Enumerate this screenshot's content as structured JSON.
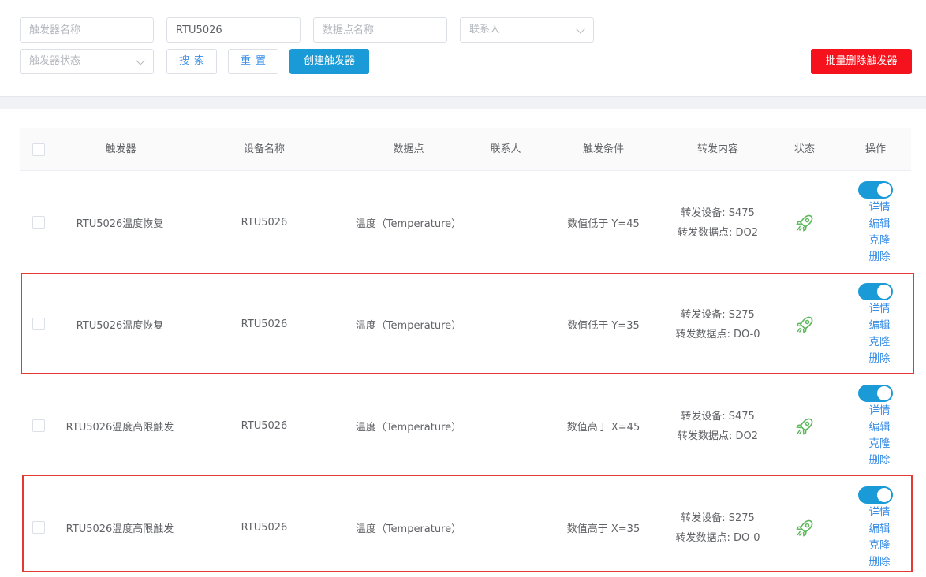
{
  "filters": {
    "trigger_name_placeholder": "触发器名称",
    "device_name_value": "RTU5026",
    "datapoint_name_placeholder": "数据点名称",
    "contact_placeholder": "联系人",
    "trigger_status_placeholder": "触发器状态"
  },
  "buttons": {
    "search": "搜索",
    "reset": "重置",
    "create": "创建触发器",
    "batch_delete": "批量删除触发器"
  },
  "table": {
    "headers": [
      "触发器",
      "设备名称",
      "数据点",
      "联系人",
      "触发条件",
      "转发内容",
      "状态",
      "操作"
    ],
    "rows": [
      {
        "trigger": "RTU5026温度恢复",
        "device": "RTU5026",
        "datapoint": "温度（Temperature）",
        "contact": "",
        "condition": "数值低于 Y=45",
        "forward_device": "转发设备: S475",
        "forward_point": "转发数据点: DO2",
        "enabled": true,
        "highlighted": false
      },
      {
        "trigger": "RTU5026温度恢复",
        "device": "RTU5026",
        "datapoint": "温度（Temperature）",
        "contact": "",
        "condition": "数值低于 Y=35",
        "forward_device": "转发设备: S275",
        "forward_point": "转发数据点: DO-0",
        "enabled": true,
        "highlighted": true
      },
      {
        "trigger": "RTU5026温度高限触发",
        "device": "RTU5026",
        "datapoint": "温度（Temperature）",
        "contact": "",
        "condition": "数值高于 X=45",
        "forward_device": "转发设备: S475",
        "forward_point": "转发数据点: DO2",
        "enabled": true,
        "highlighted": false
      },
      {
        "trigger": "RTU5026温度高限触发",
        "device": "RTU5026",
        "datapoint": "温度（Temperature）",
        "contact": "",
        "condition": "数值高于 X=35",
        "forward_device": "转发设备: S275",
        "forward_point": "转发数据点: DO-0",
        "enabled": true,
        "highlighted": true
      }
    ],
    "row_actions": [
      "详情",
      "编辑",
      "克隆",
      "删除"
    ]
  },
  "icons": {
    "status_icon": "rocket-icon",
    "dropdown_icon": "chevron-down-icon"
  },
  "colors": {
    "primary": "#1a9ad6",
    "danger": "#f5121d",
    "link": "#3a8ee6",
    "status_green": "#5cb85c",
    "highlight_box": "#e53935"
  }
}
